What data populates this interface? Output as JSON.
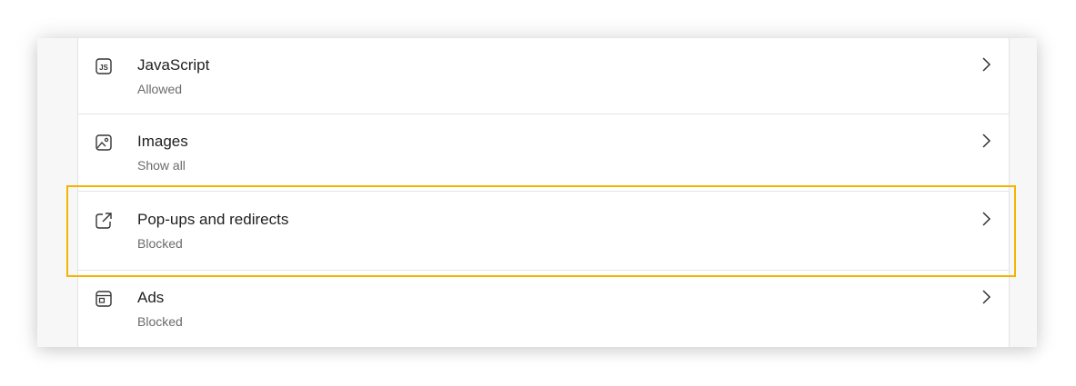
{
  "settings": {
    "items": [
      {
        "title": "JavaScript",
        "status": "Allowed",
        "icon": "javascript-icon"
      },
      {
        "title": "Images",
        "status": "Show all",
        "icon": "image-icon"
      },
      {
        "title": "Pop-ups and redirects",
        "status": "Blocked",
        "icon": "external-link-icon"
      },
      {
        "title": "Ads",
        "status": "Blocked",
        "icon": "ads-icon"
      }
    ]
  },
  "colors": {
    "highlight": "#f4b400",
    "title_text": "#1f1f1f",
    "status_text": "#6b6b6b",
    "divider": "#e5e5e5"
  }
}
